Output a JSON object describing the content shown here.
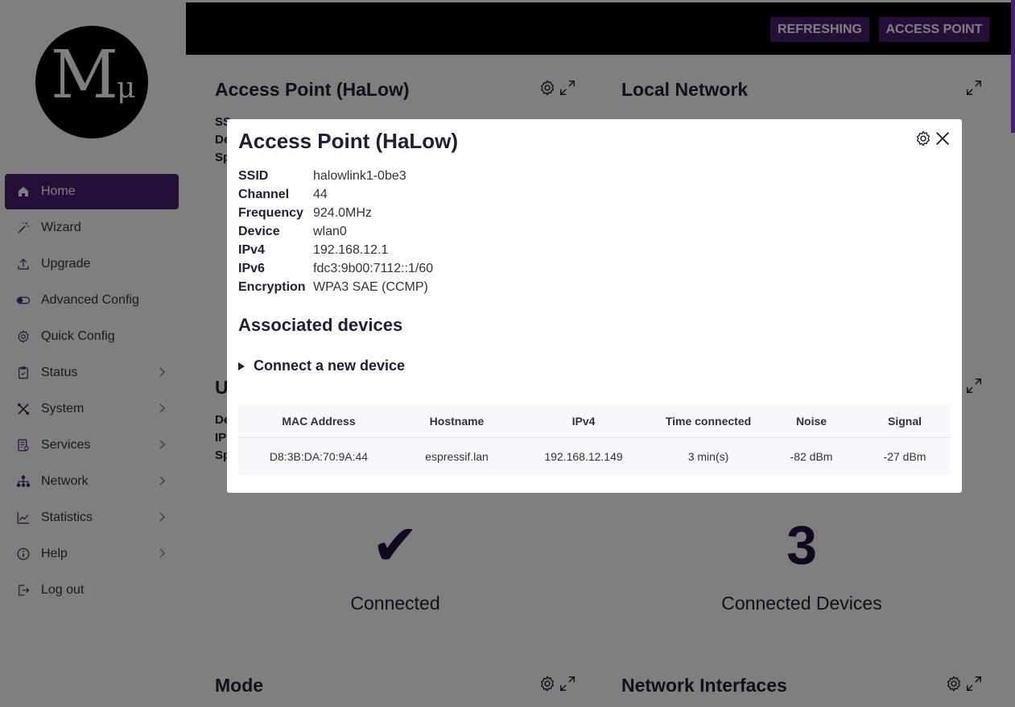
{
  "sidebar": {
    "logo": {
      "letter": "M",
      "sub": "μ"
    },
    "items": [
      {
        "label": "Home",
        "icon": "home-icon",
        "active": true,
        "chevron": false
      },
      {
        "label": "Wizard",
        "icon": "wand-icon",
        "active": false,
        "chevron": false
      },
      {
        "label": "Upgrade",
        "icon": "upload-icon",
        "active": false,
        "chevron": false
      },
      {
        "label": "Advanced Config",
        "icon": "toggle-icon",
        "active": false,
        "chevron": false
      },
      {
        "label": "Quick Config",
        "icon": "gear-icon",
        "active": false,
        "chevron": false
      },
      {
        "label": "Status",
        "icon": "clipboard-icon",
        "active": false,
        "chevron": true
      },
      {
        "label": "System",
        "icon": "tools-icon",
        "active": false,
        "chevron": true
      },
      {
        "label": "Services",
        "icon": "services-icon",
        "active": false,
        "chevron": true
      },
      {
        "label": "Network",
        "icon": "network-icon",
        "active": false,
        "chevron": true
      },
      {
        "label": "Statistics",
        "icon": "chart-icon",
        "active": false,
        "chevron": true
      },
      {
        "label": "Help",
        "icon": "info-icon",
        "active": false,
        "chevron": true
      },
      {
        "label": "Log out",
        "icon": "logout-icon",
        "active": false,
        "chevron": false
      }
    ]
  },
  "topbar": {
    "refreshing_label": "REFRESHING",
    "mode_label": "ACCESS POINT"
  },
  "cards": {
    "access_point": {
      "title": "Access Point (HaLow)"
    },
    "local_network": {
      "title": "Local Network"
    },
    "uplink": {
      "title_partial": "U",
      "symbol": "✔",
      "label": "Connected"
    },
    "devices": {
      "count": "3",
      "label": "Connected Devices"
    },
    "mode": {
      "title": "Mode"
    },
    "interfaces": {
      "title": "Network Interfaces"
    }
  },
  "modal": {
    "title": "Access Point (HaLow)",
    "info": [
      {
        "label": "SSID",
        "value": "halowlink1-0be3"
      },
      {
        "label": "Channel",
        "value": "44"
      },
      {
        "label": "Frequency",
        "value": "924.0MHz"
      },
      {
        "label": "Device",
        "value": "wlan0"
      },
      {
        "label": "IPv4",
        "value": "192.168.12.1"
      },
      {
        "label": "IPv6",
        "value": "fdc3:9b00:7112::1/60"
      },
      {
        "label": "Encryption",
        "value": "WPA3 SAE (CCMP)"
      }
    ],
    "associated_title": "Associated devices",
    "connect_label": "Connect a new device",
    "table": {
      "headers": [
        "MAC Address",
        "Hostname",
        "IPv4",
        "Time connected",
        "Noise",
        "Signal"
      ],
      "rows": [
        [
          "D8:3B:DA:70:9A:44",
          "espressif.lan",
          "192.168.12.149",
          "3 min(s)",
          "-82 dBm",
          "-27 dBm"
        ]
      ]
    }
  },
  "colors": {
    "accent": "#4a1d6e",
    "topbar": "#000000",
    "dark_text": "#1f1f3a"
  }
}
